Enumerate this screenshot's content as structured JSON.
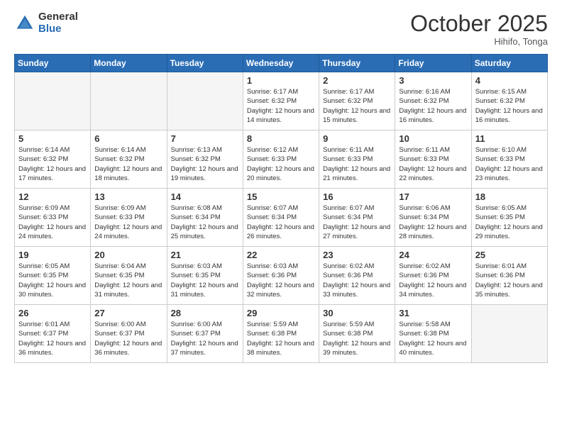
{
  "logo": {
    "general": "General",
    "blue": "Blue"
  },
  "title": "October 2025",
  "location": "Hihifo, Tonga",
  "days_of_week": [
    "Sunday",
    "Monday",
    "Tuesday",
    "Wednesday",
    "Thursday",
    "Friday",
    "Saturday"
  ],
  "weeks": [
    [
      {
        "day": "",
        "info": ""
      },
      {
        "day": "",
        "info": ""
      },
      {
        "day": "",
        "info": ""
      },
      {
        "day": "1",
        "info": "Sunrise: 6:17 AM\nSunset: 6:32 PM\nDaylight: 12 hours and 14 minutes."
      },
      {
        "day": "2",
        "info": "Sunrise: 6:17 AM\nSunset: 6:32 PM\nDaylight: 12 hours and 15 minutes."
      },
      {
        "day": "3",
        "info": "Sunrise: 6:16 AM\nSunset: 6:32 PM\nDaylight: 12 hours and 16 minutes."
      },
      {
        "day": "4",
        "info": "Sunrise: 6:15 AM\nSunset: 6:32 PM\nDaylight: 12 hours and 16 minutes."
      }
    ],
    [
      {
        "day": "5",
        "info": "Sunrise: 6:14 AM\nSunset: 6:32 PM\nDaylight: 12 hours and 17 minutes."
      },
      {
        "day": "6",
        "info": "Sunrise: 6:14 AM\nSunset: 6:32 PM\nDaylight: 12 hours and 18 minutes."
      },
      {
        "day": "7",
        "info": "Sunrise: 6:13 AM\nSunset: 6:32 PM\nDaylight: 12 hours and 19 minutes."
      },
      {
        "day": "8",
        "info": "Sunrise: 6:12 AM\nSunset: 6:33 PM\nDaylight: 12 hours and 20 minutes."
      },
      {
        "day": "9",
        "info": "Sunrise: 6:11 AM\nSunset: 6:33 PM\nDaylight: 12 hours and 21 minutes."
      },
      {
        "day": "10",
        "info": "Sunrise: 6:11 AM\nSunset: 6:33 PM\nDaylight: 12 hours and 22 minutes."
      },
      {
        "day": "11",
        "info": "Sunrise: 6:10 AM\nSunset: 6:33 PM\nDaylight: 12 hours and 23 minutes."
      }
    ],
    [
      {
        "day": "12",
        "info": "Sunrise: 6:09 AM\nSunset: 6:33 PM\nDaylight: 12 hours and 24 minutes."
      },
      {
        "day": "13",
        "info": "Sunrise: 6:09 AM\nSunset: 6:33 PM\nDaylight: 12 hours and 24 minutes."
      },
      {
        "day": "14",
        "info": "Sunrise: 6:08 AM\nSunset: 6:34 PM\nDaylight: 12 hours and 25 minutes."
      },
      {
        "day": "15",
        "info": "Sunrise: 6:07 AM\nSunset: 6:34 PM\nDaylight: 12 hours and 26 minutes."
      },
      {
        "day": "16",
        "info": "Sunrise: 6:07 AM\nSunset: 6:34 PM\nDaylight: 12 hours and 27 minutes."
      },
      {
        "day": "17",
        "info": "Sunrise: 6:06 AM\nSunset: 6:34 PM\nDaylight: 12 hours and 28 minutes."
      },
      {
        "day": "18",
        "info": "Sunrise: 6:05 AM\nSunset: 6:35 PM\nDaylight: 12 hours and 29 minutes."
      }
    ],
    [
      {
        "day": "19",
        "info": "Sunrise: 6:05 AM\nSunset: 6:35 PM\nDaylight: 12 hours and 30 minutes."
      },
      {
        "day": "20",
        "info": "Sunrise: 6:04 AM\nSunset: 6:35 PM\nDaylight: 12 hours and 31 minutes."
      },
      {
        "day": "21",
        "info": "Sunrise: 6:03 AM\nSunset: 6:35 PM\nDaylight: 12 hours and 31 minutes."
      },
      {
        "day": "22",
        "info": "Sunrise: 6:03 AM\nSunset: 6:36 PM\nDaylight: 12 hours and 32 minutes."
      },
      {
        "day": "23",
        "info": "Sunrise: 6:02 AM\nSunset: 6:36 PM\nDaylight: 12 hours and 33 minutes."
      },
      {
        "day": "24",
        "info": "Sunrise: 6:02 AM\nSunset: 6:36 PM\nDaylight: 12 hours and 34 minutes."
      },
      {
        "day": "25",
        "info": "Sunrise: 6:01 AM\nSunset: 6:36 PM\nDaylight: 12 hours and 35 minutes."
      }
    ],
    [
      {
        "day": "26",
        "info": "Sunrise: 6:01 AM\nSunset: 6:37 PM\nDaylight: 12 hours and 36 minutes."
      },
      {
        "day": "27",
        "info": "Sunrise: 6:00 AM\nSunset: 6:37 PM\nDaylight: 12 hours and 36 minutes."
      },
      {
        "day": "28",
        "info": "Sunrise: 6:00 AM\nSunset: 6:37 PM\nDaylight: 12 hours and 37 minutes."
      },
      {
        "day": "29",
        "info": "Sunrise: 5:59 AM\nSunset: 6:38 PM\nDaylight: 12 hours and 38 minutes."
      },
      {
        "day": "30",
        "info": "Sunrise: 5:59 AM\nSunset: 6:38 PM\nDaylight: 12 hours and 39 minutes."
      },
      {
        "day": "31",
        "info": "Sunrise: 5:58 AM\nSunset: 6:38 PM\nDaylight: 12 hours and 40 minutes."
      },
      {
        "day": "",
        "info": ""
      }
    ]
  ]
}
